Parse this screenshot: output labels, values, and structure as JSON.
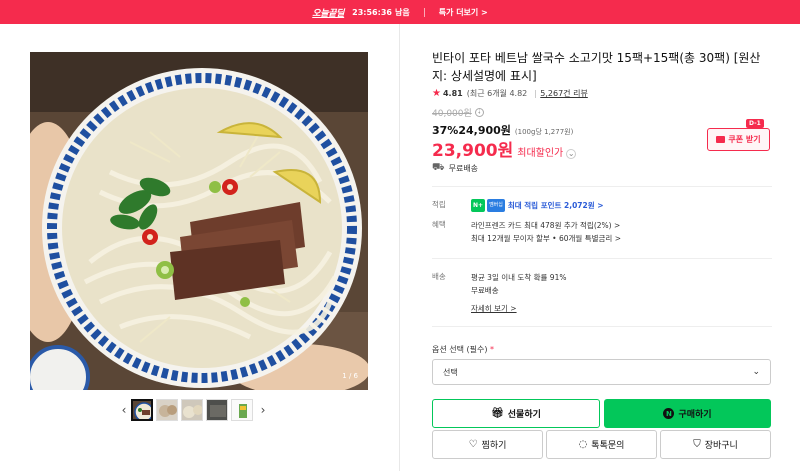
{
  "promo_bar": {
    "logo": "오늘끝딜",
    "timer": "23:56:36",
    "timer_suffix": "남음",
    "more_link": "특가 더보기 >"
  },
  "gallery": {
    "counter": "1 / 6",
    "prev_icon": "chevron-left-icon",
    "next_icon": "chevron-right-icon",
    "thumbnail_count": 5,
    "active_index": 0
  },
  "product": {
    "title": "빈타이 포타 베트남 쌀국수 소고기맛 15팩+15팩(총 30팩) [원산지: 상세설명에 표시]",
    "rating": "4.81",
    "rating_recent": "(최근 6개월 4.82",
    "review_count": "5,267건 리뷰",
    "original_price": "40,000원",
    "discount_rate": "37%",
    "sale_price": "24,900원",
    "unit_price": "(100g당 1,277원)",
    "max_discount_price": "23,900원",
    "max_discount_label": "최대할인가",
    "shipping_summary": "무료배송"
  },
  "coupon": {
    "dday": "D-1",
    "label": "쿠폰 받기"
  },
  "benefits": {
    "points_key": "적립",
    "points_badge": "N+",
    "points_badge2": "멤버십",
    "points_text": "최대 적립 포인트 2,072원 >",
    "card_key": "혜택",
    "card_line1": "라인프렌즈 카드 최대 478원 추가 적립(2%) >",
    "card_line2": "최대 12개월 무이자 할부 • 60개월 특별금리 >"
  },
  "delivery": {
    "key": "배송",
    "line1": "평균 3일 이내 도착 확률 91%",
    "line2": "무료배송",
    "detail_link": "자세히 보기 >"
  },
  "options": {
    "label": "옵션 선택 (필수)",
    "required_mark": "*",
    "select_value": "선택"
  },
  "actions": {
    "gift": "선물하기",
    "buy": "구매하기",
    "wish": "찜하기",
    "talk": "톡톡문의",
    "cart": "장바구니"
  },
  "colors": {
    "brand_red": "#f52b4d",
    "naver_green": "#03c75a"
  }
}
